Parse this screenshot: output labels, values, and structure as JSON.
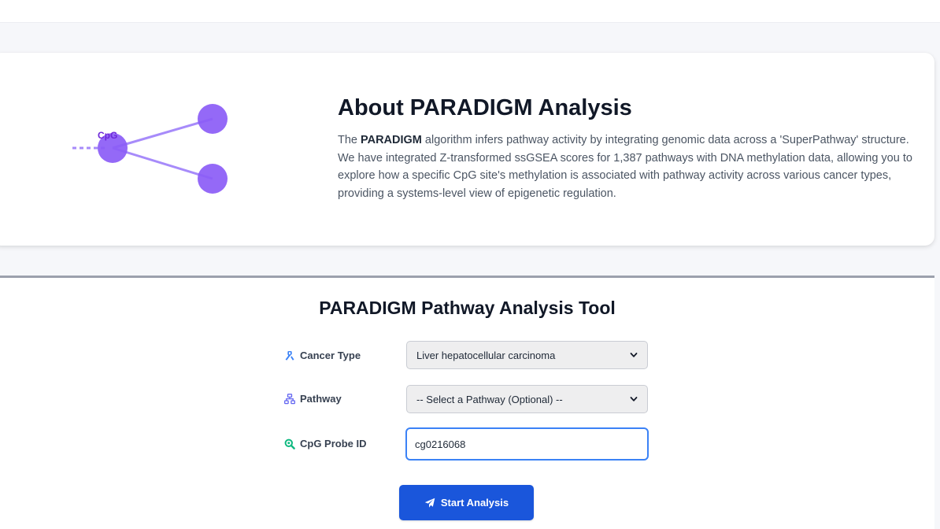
{
  "about": {
    "diagram_label": "CpG",
    "title": "About PARADIGM Analysis",
    "desc_prefix": "The ",
    "desc_bold": "PARADIGM",
    "desc_rest": " algorithm infers pathway activity by integrating genomic data across a 'SuperPathway' structure. We have integrated Z-transformed ssGSEA scores for 1,387 pathways with DNA methylation data, allowing you to explore how a specific CpG site's methylation is associated with pathway activity across various cancer types, providing a systems-level view of epigenetic regulation."
  },
  "tool": {
    "title": "PARADIGM Pathway Analysis Tool",
    "cancer_type": {
      "label": "Cancer Type",
      "icon": "ribbon-icon",
      "selected": "Liver hepatocellular carcinoma"
    },
    "pathway": {
      "label": "Pathway",
      "icon": "sitemap-icon",
      "selected": "-- Select a Pathway (Optional) --"
    },
    "cpg_probe": {
      "label": "CpG Probe ID",
      "icon": "search-icon",
      "value": "cg0216068"
    },
    "submit": {
      "label": "Start Analysis",
      "icon": "paper-plane-icon"
    }
  },
  "colors": {
    "node": "#8b5cf6",
    "primary_button": "#1a56db",
    "focus_border": "#3b82f6",
    "ribbon": "#3b82f6",
    "sitemap": "#6366f1",
    "search": "#10b981"
  }
}
